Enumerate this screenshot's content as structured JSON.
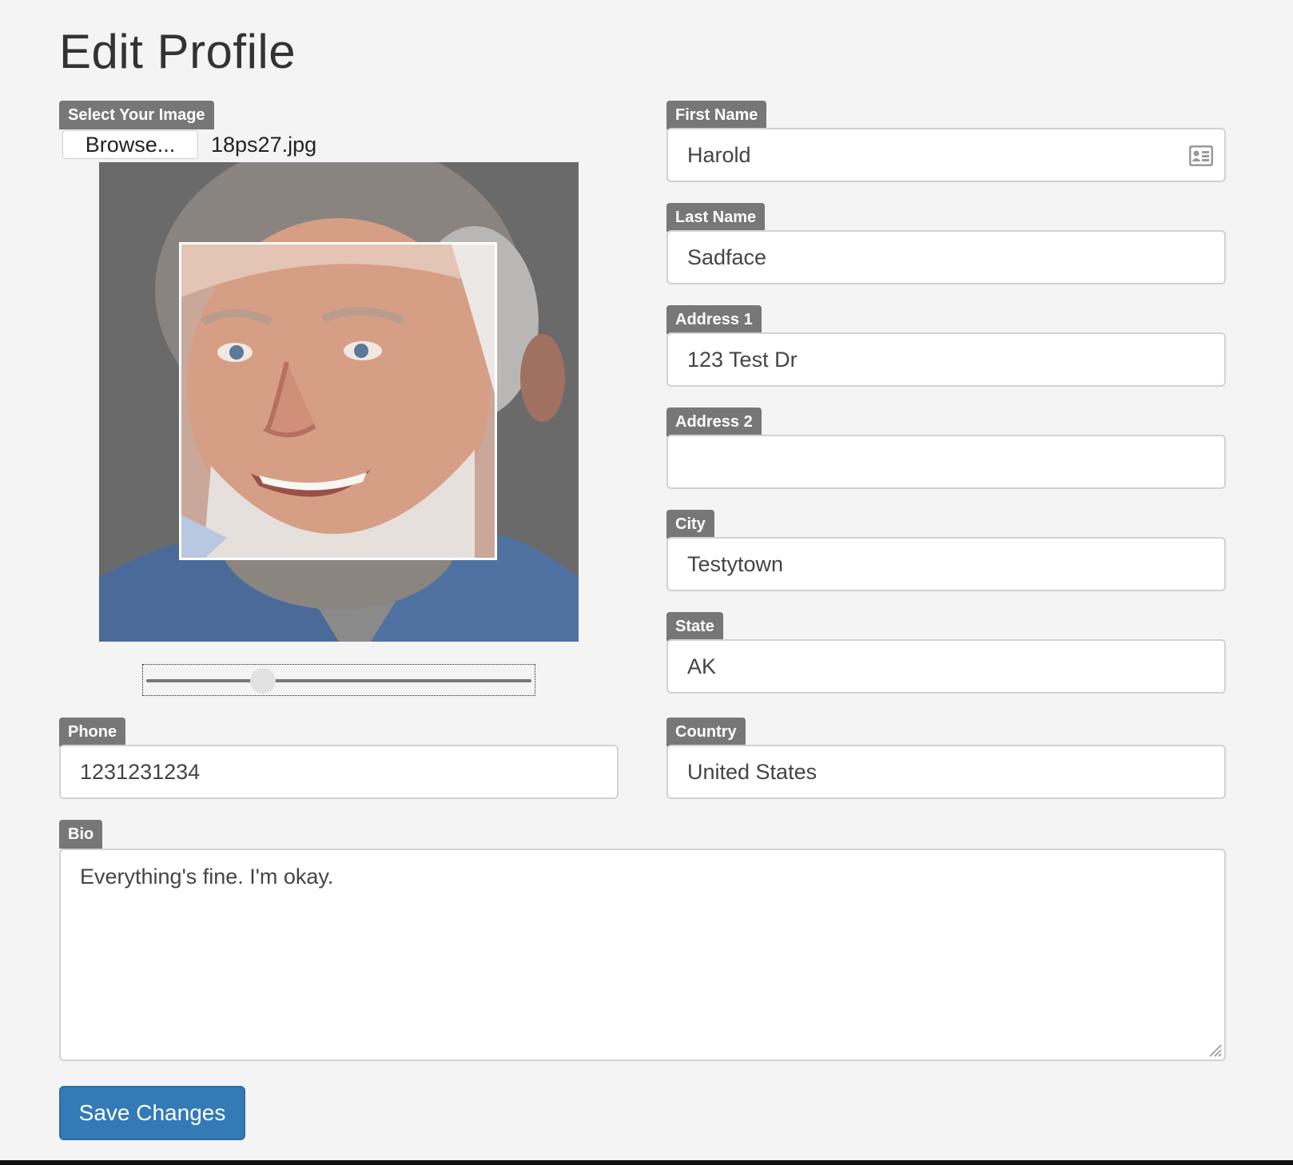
{
  "page": {
    "title": "Edit Profile"
  },
  "image_picker": {
    "label": "Select Your Image",
    "browse_label": "Browse...",
    "file_name": "18ps27.jpg",
    "zoom_level": 0.3
  },
  "fields": {
    "first_name": {
      "label": "First Name",
      "value": "Harold",
      "icon": "contact-card-icon"
    },
    "last_name": {
      "label": "Last Name",
      "value": "Sadface"
    },
    "address1": {
      "label": "Address 1",
      "value": "123 Test Dr"
    },
    "address2": {
      "label": "Address 2",
      "value": ""
    },
    "city": {
      "label": "City",
      "value": "Testytown"
    },
    "state": {
      "label": "State",
      "value": "AK"
    },
    "phone": {
      "label": "Phone",
      "value": "1231231234"
    },
    "country": {
      "label": "Country",
      "value": "United States"
    },
    "bio": {
      "label": "Bio",
      "value": "Everything's fine. I'm okay."
    }
  },
  "actions": {
    "save_label": "Save Changes"
  },
  "colors": {
    "background": "#f4f4f4",
    "label_tag": "#777777",
    "primary_button": "#337ab7"
  }
}
